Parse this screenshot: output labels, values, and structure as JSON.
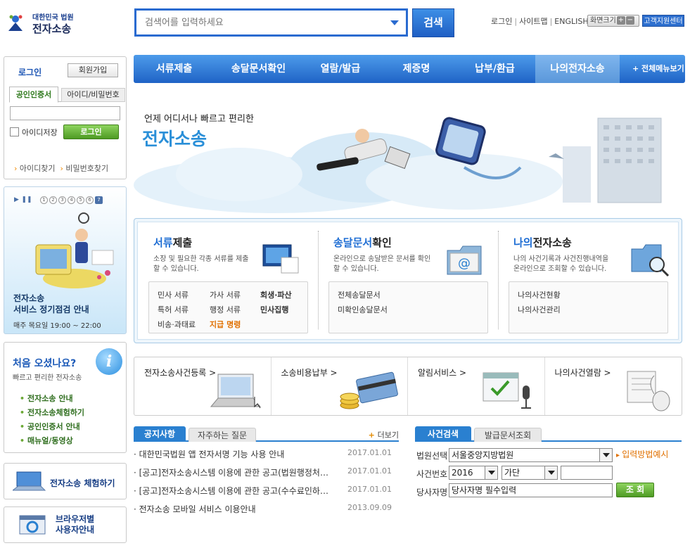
{
  "header": {
    "logo_small": "대한민국 법원",
    "logo_big": "전자소송",
    "search_placeholder": "검색어를 입력하세요",
    "search_button": "검색",
    "util_links": [
      "로그인",
      "사이트맵",
      "ENGLISH"
    ],
    "zoom_label": "화면크기",
    "zoom_plus": "+",
    "zoom_minus": "−",
    "support_label": "고객지원센터"
  },
  "nav": {
    "items": [
      "서류제출",
      "송달문서확인",
      "열람/발급",
      "제증명",
      "납부/환급",
      "나의전자소송"
    ],
    "all_menu": "+ 전체메뉴보기"
  },
  "login": {
    "title": "로그인",
    "join": "회원가입",
    "tab_cert": "공인인증서",
    "tab_id": "아이디/비밀번호",
    "save_id": "아이디저장",
    "button": "로그인",
    "find_id": "아이디찾기",
    "find_pw": "비밀번호찾기"
  },
  "notice_banner": {
    "pages": [
      "1",
      "2",
      "3",
      "4",
      "5",
      "6",
      "7"
    ],
    "line1": "전자소송",
    "line2": "서비스 정기점검 안내",
    "schedule": "매주 목요일 19:00 ~ 22:00"
  },
  "first_visit": {
    "title": "처음 오셨나요?",
    "subtitle": "빠르고 편리한 전자소송",
    "links": [
      "전자소송 안내",
      "전자소송체험하기",
      "공인인증서 안내",
      "매뉴얼/동영상"
    ],
    "info_icon": "i"
  },
  "side_buttons": {
    "experience": "전자소송 체험하기",
    "browser_line1": "브라우저별",
    "browser_line2": "사용자안내"
  },
  "hero": {
    "tagline": "언제 어디서나 빠르고 편리한",
    "title": "전자소송"
  },
  "services": [
    {
      "title_strong": "서류",
      "title_rest": "제출",
      "desc": "소장 및 필요한 각종 서류를 제출할 수 있습니다.",
      "links": [
        "민사 서류",
        "가사 서류",
        "회생·파산",
        "특허 서류",
        "행정 서류",
        "민사집행",
        "비송·과태료",
        "지급 명령"
      ]
    },
    {
      "title_strong": "송달문서",
      "title_rest": "확인",
      "desc": "온라인으로 송달받은 문서를 확인 할 수 있습니다.",
      "links": [
        "전체송달문서",
        "미확인송달문서"
      ]
    },
    {
      "title_strong": "나의",
      "title_rest": "전자소송",
      "desc": "나의 사건기록과 사건진행내역을 온라인으로 조회할 수 있습니다.",
      "links": [
        "나의사건현황",
        "나의사건관리"
      ]
    }
  ],
  "quick_links": [
    "전자소송사건등록 >",
    "소송비용납부 >",
    "알림서비스 >",
    "나의사건열람 >"
  ],
  "board": {
    "tab_notice": "공지사항",
    "tab_faq": "자주하는 질문",
    "more": "더보기",
    "items": [
      {
        "title": "· 대한민국법원 앱 전자서명 기능 사용 안내",
        "date": "2017.01.01"
      },
      {
        "title": "· [공고]전자소송시스템 이용에 관한 공고(법원행정처…",
        "date": "2017.01.01"
      },
      {
        "title": "· [공고]전자소송시스템 이용에 관한 공고(수수료인하…",
        "date": "2017.01.01"
      },
      {
        "title": "· 전자소송 모바일 서비스 이용안내",
        "date": "2013.09.09"
      }
    ]
  },
  "case_search": {
    "tab_case": "사건검색",
    "tab_doc": "발급문서조회",
    "court_label": "법원선택",
    "court_value": "서울중앙지방법원",
    "input_hint": "입력방법예시",
    "case_label": "사건번호",
    "year_value": "2016",
    "type_value": "가단",
    "party_label": "당사자명",
    "party_placeholder": "당사자명 필수입력",
    "search_button": "조 회"
  },
  "colors": {
    "nav_blue": "#1f63c6",
    "accent_blue": "#2a80d0",
    "green_button": "#4e9b23",
    "orange": "#e07000"
  }
}
